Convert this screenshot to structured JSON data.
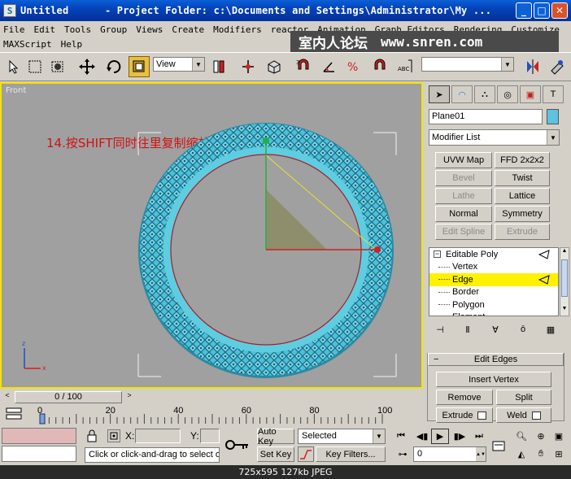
{
  "window": {
    "title": "Untitled      - Project Folder: c:\\Documents and Settings\\Administrator\\My ...",
    "app_icon": "3ds-max-icon",
    "buttons": [
      "minimize-icon",
      "maximize-icon",
      "close-icon"
    ]
  },
  "menu": {
    "row1": [
      "File",
      "Edit",
      "Tools",
      "Group",
      "Views",
      "Create",
      "Modifiers",
      "reactor",
      "Animation",
      "Graph Editors",
      "Rendering",
      "Customize"
    ],
    "row2": [
      "MAXScript",
      "Help"
    ]
  },
  "watermark": {
    "cn": "室内人论坛",
    "url": "www.snren.com"
  },
  "toolbar": {
    "reference_coord": "View",
    "named_selection": ""
  },
  "viewport": {
    "label": "Front",
    "caption": "14.按SHIFT同时往里复制缩放",
    "background": "#a0a0a0",
    "active_border": "#f4e300",
    "ring_color": "#4cc0d8"
  },
  "command_panel": {
    "object_name": "Plane01",
    "object_color": "#5ec2e0",
    "modifier_list": "Modifier List",
    "modifier_buttons": [
      {
        "label": "UVW Map",
        "enabled": true
      },
      {
        "label": "FFD 2x2x2",
        "enabled": true
      },
      {
        "label": "Bevel",
        "enabled": false
      },
      {
        "label": "Twist",
        "enabled": true
      },
      {
        "label": "Lathe",
        "enabled": false
      },
      {
        "label": "Lattice",
        "enabled": true
      },
      {
        "label": "Normal",
        "enabled": true
      },
      {
        "label": "Symmetry",
        "enabled": true
      },
      {
        "label": "Edit Spline",
        "enabled": false
      },
      {
        "label": "Extrude",
        "enabled": false
      }
    ],
    "stack": {
      "root": "Editable Poly",
      "items": [
        "Vertex",
        "Edge",
        "Border",
        "Polygon",
        "Element"
      ],
      "selected": "Edge"
    },
    "rollout": {
      "title": "Edit Edges",
      "insert_vertex": "Insert Vertex",
      "remove": "Remove",
      "split": "Split",
      "extrude": "Extrude",
      "weld": "Weld"
    }
  },
  "timeline": {
    "slider": "0 / 100",
    "left_arrow": "<",
    "right_arrow": ">",
    "ruler_labels": [
      "0",
      "20",
      "40",
      "60",
      "80",
      "100"
    ]
  },
  "status": {
    "x_label": "X:",
    "y_label": "Y:",
    "prompt": "Click or click-and-drag to select objects",
    "auto_key": "Auto Key",
    "set_key": "Set Key",
    "selection_set": "Selected",
    "key_filters": "Key Filters...",
    "frame": "0"
  },
  "caption": "725x595  127kb  JPEG"
}
